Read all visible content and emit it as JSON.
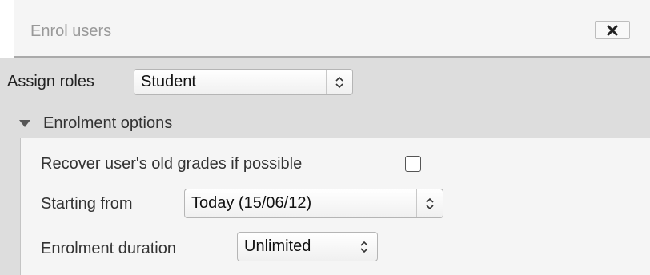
{
  "dialog": {
    "title": "Enrol users",
    "close_icon": "close-icon"
  },
  "assign_roles": {
    "label": "Assign roles",
    "selected": "Student"
  },
  "enrolment_options": {
    "label": "Enrolment options",
    "expanded": true,
    "recover_grades": {
      "label": "Recover user's old grades if possible",
      "checked": false
    },
    "starting_from": {
      "label": "Starting from",
      "selected": "Today (15/06/12)"
    },
    "duration": {
      "label": "Enrolment duration",
      "selected": "Unlimited"
    }
  }
}
